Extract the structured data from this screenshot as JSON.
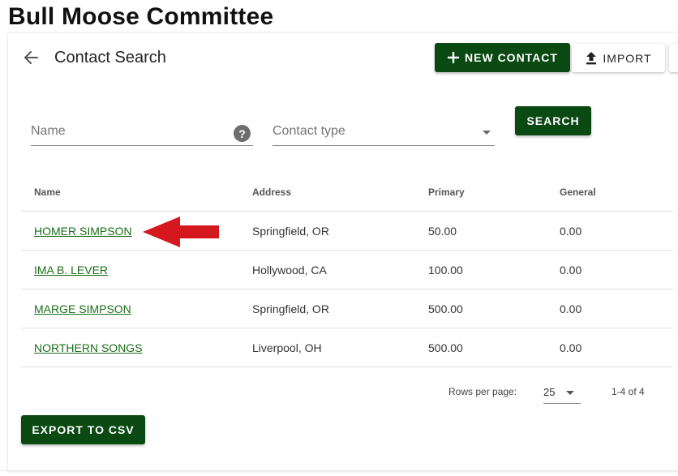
{
  "org": {
    "title": "Bull Moose Committee"
  },
  "header": {
    "title": "Contact Search",
    "new_contact_label": "NEW CONTACT",
    "import_label": "IMPORT"
  },
  "search": {
    "name_placeholder": "Name",
    "contact_type_placeholder": "Contact type",
    "search_label": "SEARCH",
    "help_icon": "?"
  },
  "table": {
    "columns": [
      "Name",
      "Address",
      "Primary",
      "General"
    ],
    "rows": [
      {
        "name": "HOMER SIMPSON",
        "address": "Springfield, OR",
        "primary": "50.00",
        "general": "0.00"
      },
      {
        "name": "IMA B. LEVER",
        "address": "Hollywood, CA",
        "primary": "100.00",
        "general": "0.00"
      },
      {
        "name": "MARGE SIMPSON",
        "address": "Springfield, OR",
        "primary": "500.00",
        "general": "0.00"
      },
      {
        "name": "NORTHERN SONGS",
        "address": "Liverpool, OH",
        "primary": "500.00",
        "general": "0.00"
      }
    ]
  },
  "pagination": {
    "rows_per_page_label": "Rows per page:",
    "rows_per_page_value": "25",
    "range": "1-4 of 4"
  },
  "footer": {
    "export_label": "EXPORT TO CSV"
  },
  "colors": {
    "primary_green": "#0a4a12",
    "link_green": "#1a6e1a",
    "annotation_arrow": "#d4181e"
  },
  "icons": {
    "back": "arrow-left-icon",
    "new_contact": "plus-icon",
    "import": "upload-icon",
    "help": "help-circle-icon",
    "dropdown": "caret-down-icon",
    "annotation": "red-arrow-icon"
  }
}
